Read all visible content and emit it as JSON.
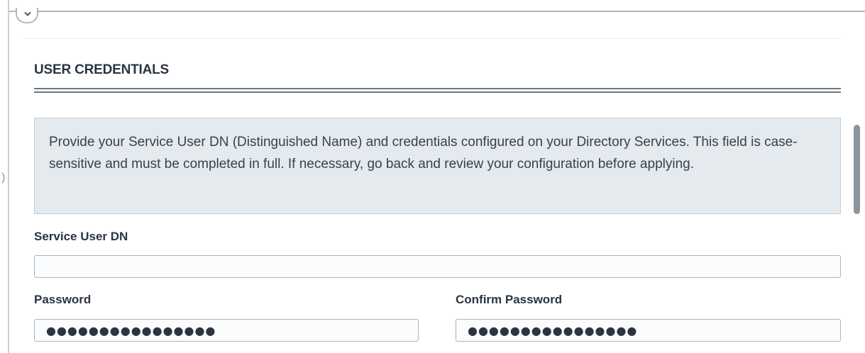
{
  "section": {
    "title": "USER CREDENTIALS",
    "info_text": "Provide your Service User DN (Distinguished Name) and credentials configured on your Directory Services. This field is case-sensitive and must be completed in full. If necessary, go back and review your configuration before applying."
  },
  "fields": {
    "service_user_dn": {
      "label": "Service User DN",
      "value": ""
    },
    "password": {
      "label": "Password",
      "masked_value": "●●●●●●●●●●●●●●●●"
    },
    "confirm_password": {
      "label": "Confirm Password",
      "masked_value": "●●●●●●●●●●●●●●●●"
    }
  },
  "icons": {
    "collapse": "chevron-down-icon",
    "left_handle": "chevron-left-icon"
  },
  "colors": {
    "info_box_bg": "#e5eaee",
    "rule": "#6b7783",
    "scrollbar": "#8b959f"
  }
}
